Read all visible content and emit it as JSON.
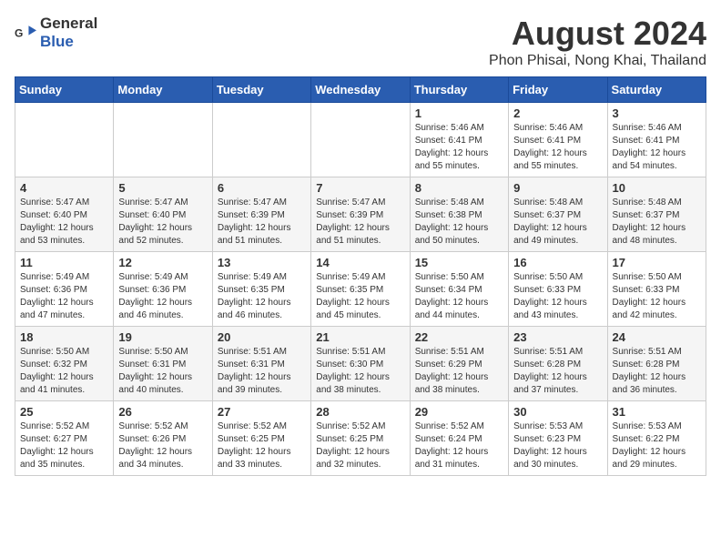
{
  "header": {
    "logo_general": "General",
    "logo_blue": "Blue",
    "month_title": "August 2024",
    "location": "Phon Phisai, Nong Khai, Thailand"
  },
  "weekdays": [
    "Sunday",
    "Monday",
    "Tuesday",
    "Wednesday",
    "Thursday",
    "Friday",
    "Saturday"
  ],
  "weeks": [
    [
      {
        "day": "",
        "info": ""
      },
      {
        "day": "",
        "info": ""
      },
      {
        "day": "",
        "info": ""
      },
      {
        "day": "",
        "info": ""
      },
      {
        "day": "1",
        "info": "Sunrise: 5:46 AM\nSunset: 6:41 PM\nDaylight: 12 hours\nand 55 minutes."
      },
      {
        "day": "2",
        "info": "Sunrise: 5:46 AM\nSunset: 6:41 PM\nDaylight: 12 hours\nand 55 minutes."
      },
      {
        "day": "3",
        "info": "Sunrise: 5:46 AM\nSunset: 6:41 PM\nDaylight: 12 hours\nand 54 minutes."
      }
    ],
    [
      {
        "day": "4",
        "info": "Sunrise: 5:47 AM\nSunset: 6:40 PM\nDaylight: 12 hours\nand 53 minutes."
      },
      {
        "day": "5",
        "info": "Sunrise: 5:47 AM\nSunset: 6:40 PM\nDaylight: 12 hours\nand 52 minutes."
      },
      {
        "day": "6",
        "info": "Sunrise: 5:47 AM\nSunset: 6:39 PM\nDaylight: 12 hours\nand 51 minutes."
      },
      {
        "day": "7",
        "info": "Sunrise: 5:47 AM\nSunset: 6:39 PM\nDaylight: 12 hours\nand 51 minutes."
      },
      {
        "day": "8",
        "info": "Sunrise: 5:48 AM\nSunset: 6:38 PM\nDaylight: 12 hours\nand 50 minutes."
      },
      {
        "day": "9",
        "info": "Sunrise: 5:48 AM\nSunset: 6:37 PM\nDaylight: 12 hours\nand 49 minutes."
      },
      {
        "day": "10",
        "info": "Sunrise: 5:48 AM\nSunset: 6:37 PM\nDaylight: 12 hours\nand 48 minutes."
      }
    ],
    [
      {
        "day": "11",
        "info": "Sunrise: 5:49 AM\nSunset: 6:36 PM\nDaylight: 12 hours\nand 47 minutes."
      },
      {
        "day": "12",
        "info": "Sunrise: 5:49 AM\nSunset: 6:36 PM\nDaylight: 12 hours\nand 46 minutes."
      },
      {
        "day": "13",
        "info": "Sunrise: 5:49 AM\nSunset: 6:35 PM\nDaylight: 12 hours\nand 46 minutes."
      },
      {
        "day": "14",
        "info": "Sunrise: 5:49 AM\nSunset: 6:35 PM\nDaylight: 12 hours\nand 45 minutes."
      },
      {
        "day": "15",
        "info": "Sunrise: 5:50 AM\nSunset: 6:34 PM\nDaylight: 12 hours\nand 44 minutes."
      },
      {
        "day": "16",
        "info": "Sunrise: 5:50 AM\nSunset: 6:33 PM\nDaylight: 12 hours\nand 43 minutes."
      },
      {
        "day": "17",
        "info": "Sunrise: 5:50 AM\nSunset: 6:33 PM\nDaylight: 12 hours\nand 42 minutes."
      }
    ],
    [
      {
        "day": "18",
        "info": "Sunrise: 5:50 AM\nSunset: 6:32 PM\nDaylight: 12 hours\nand 41 minutes."
      },
      {
        "day": "19",
        "info": "Sunrise: 5:50 AM\nSunset: 6:31 PM\nDaylight: 12 hours\nand 40 minutes."
      },
      {
        "day": "20",
        "info": "Sunrise: 5:51 AM\nSunset: 6:31 PM\nDaylight: 12 hours\nand 39 minutes."
      },
      {
        "day": "21",
        "info": "Sunrise: 5:51 AM\nSunset: 6:30 PM\nDaylight: 12 hours\nand 38 minutes."
      },
      {
        "day": "22",
        "info": "Sunrise: 5:51 AM\nSunset: 6:29 PM\nDaylight: 12 hours\nand 38 minutes."
      },
      {
        "day": "23",
        "info": "Sunrise: 5:51 AM\nSunset: 6:28 PM\nDaylight: 12 hours\nand 37 minutes."
      },
      {
        "day": "24",
        "info": "Sunrise: 5:51 AM\nSunset: 6:28 PM\nDaylight: 12 hours\nand 36 minutes."
      }
    ],
    [
      {
        "day": "25",
        "info": "Sunrise: 5:52 AM\nSunset: 6:27 PM\nDaylight: 12 hours\nand 35 minutes."
      },
      {
        "day": "26",
        "info": "Sunrise: 5:52 AM\nSunset: 6:26 PM\nDaylight: 12 hours\nand 34 minutes."
      },
      {
        "day": "27",
        "info": "Sunrise: 5:52 AM\nSunset: 6:25 PM\nDaylight: 12 hours\nand 33 minutes."
      },
      {
        "day": "28",
        "info": "Sunrise: 5:52 AM\nSunset: 6:25 PM\nDaylight: 12 hours\nand 32 minutes."
      },
      {
        "day": "29",
        "info": "Sunrise: 5:52 AM\nSunset: 6:24 PM\nDaylight: 12 hours\nand 31 minutes."
      },
      {
        "day": "30",
        "info": "Sunrise: 5:53 AM\nSunset: 6:23 PM\nDaylight: 12 hours\nand 30 minutes."
      },
      {
        "day": "31",
        "info": "Sunrise: 5:53 AM\nSunset: 6:22 PM\nDaylight: 12 hours\nand 29 minutes."
      }
    ]
  ]
}
